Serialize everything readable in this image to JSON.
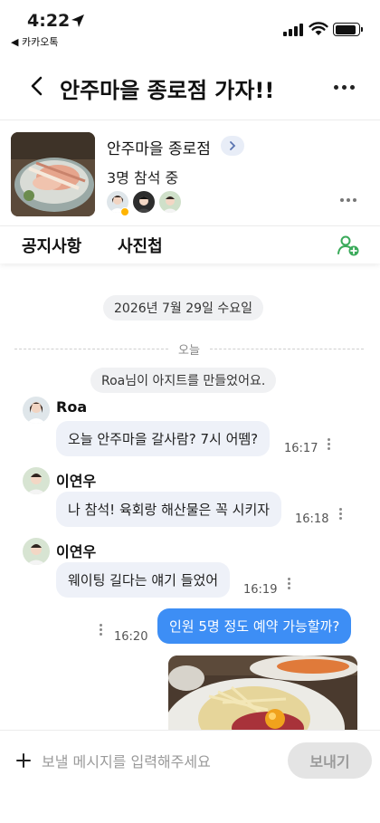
{
  "status_bar": {
    "time": "4:22",
    "back_app": "◀ 카카오톡"
  },
  "header": {
    "title": "안주마을 종로점 가자!!"
  },
  "info_card": {
    "place_name": "안주마을 종로점",
    "members": "3명 참석 중"
  },
  "tabs": [
    {
      "label": "공지사항"
    },
    {
      "label": "사진첩"
    }
  ],
  "chat": {
    "date": "2026년 7월 29일 수요일",
    "today": "오늘",
    "system": "Roa님이 아지트를 만들었어요.",
    "messages": [
      {
        "sender": "Roa",
        "text": "오늘 안주마을 갈사람? 7시 어뗌?",
        "time": "16:17"
      },
      {
        "sender": "이연우",
        "text": "나 참석! 육회랑 해산물은 꼭 시키자",
        "time": "16:18"
      },
      {
        "sender": "이연우",
        "text": "웨이팅 길다는 얘기 들었어",
        "time": "16:19"
      },
      {
        "sender": "",
        "text": "인원 5명 정도 예약 가능할까?",
        "time": "16:20"
      }
    ]
  },
  "input": {
    "placeholder": "보낼 메시지를 입력해주세요",
    "send_label": "보내기"
  },
  "colors": {
    "accent": "#3d8ef5",
    "bubble_other": "#eef1f8",
    "add_member_icon": "#3aaa5a"
  }
}
